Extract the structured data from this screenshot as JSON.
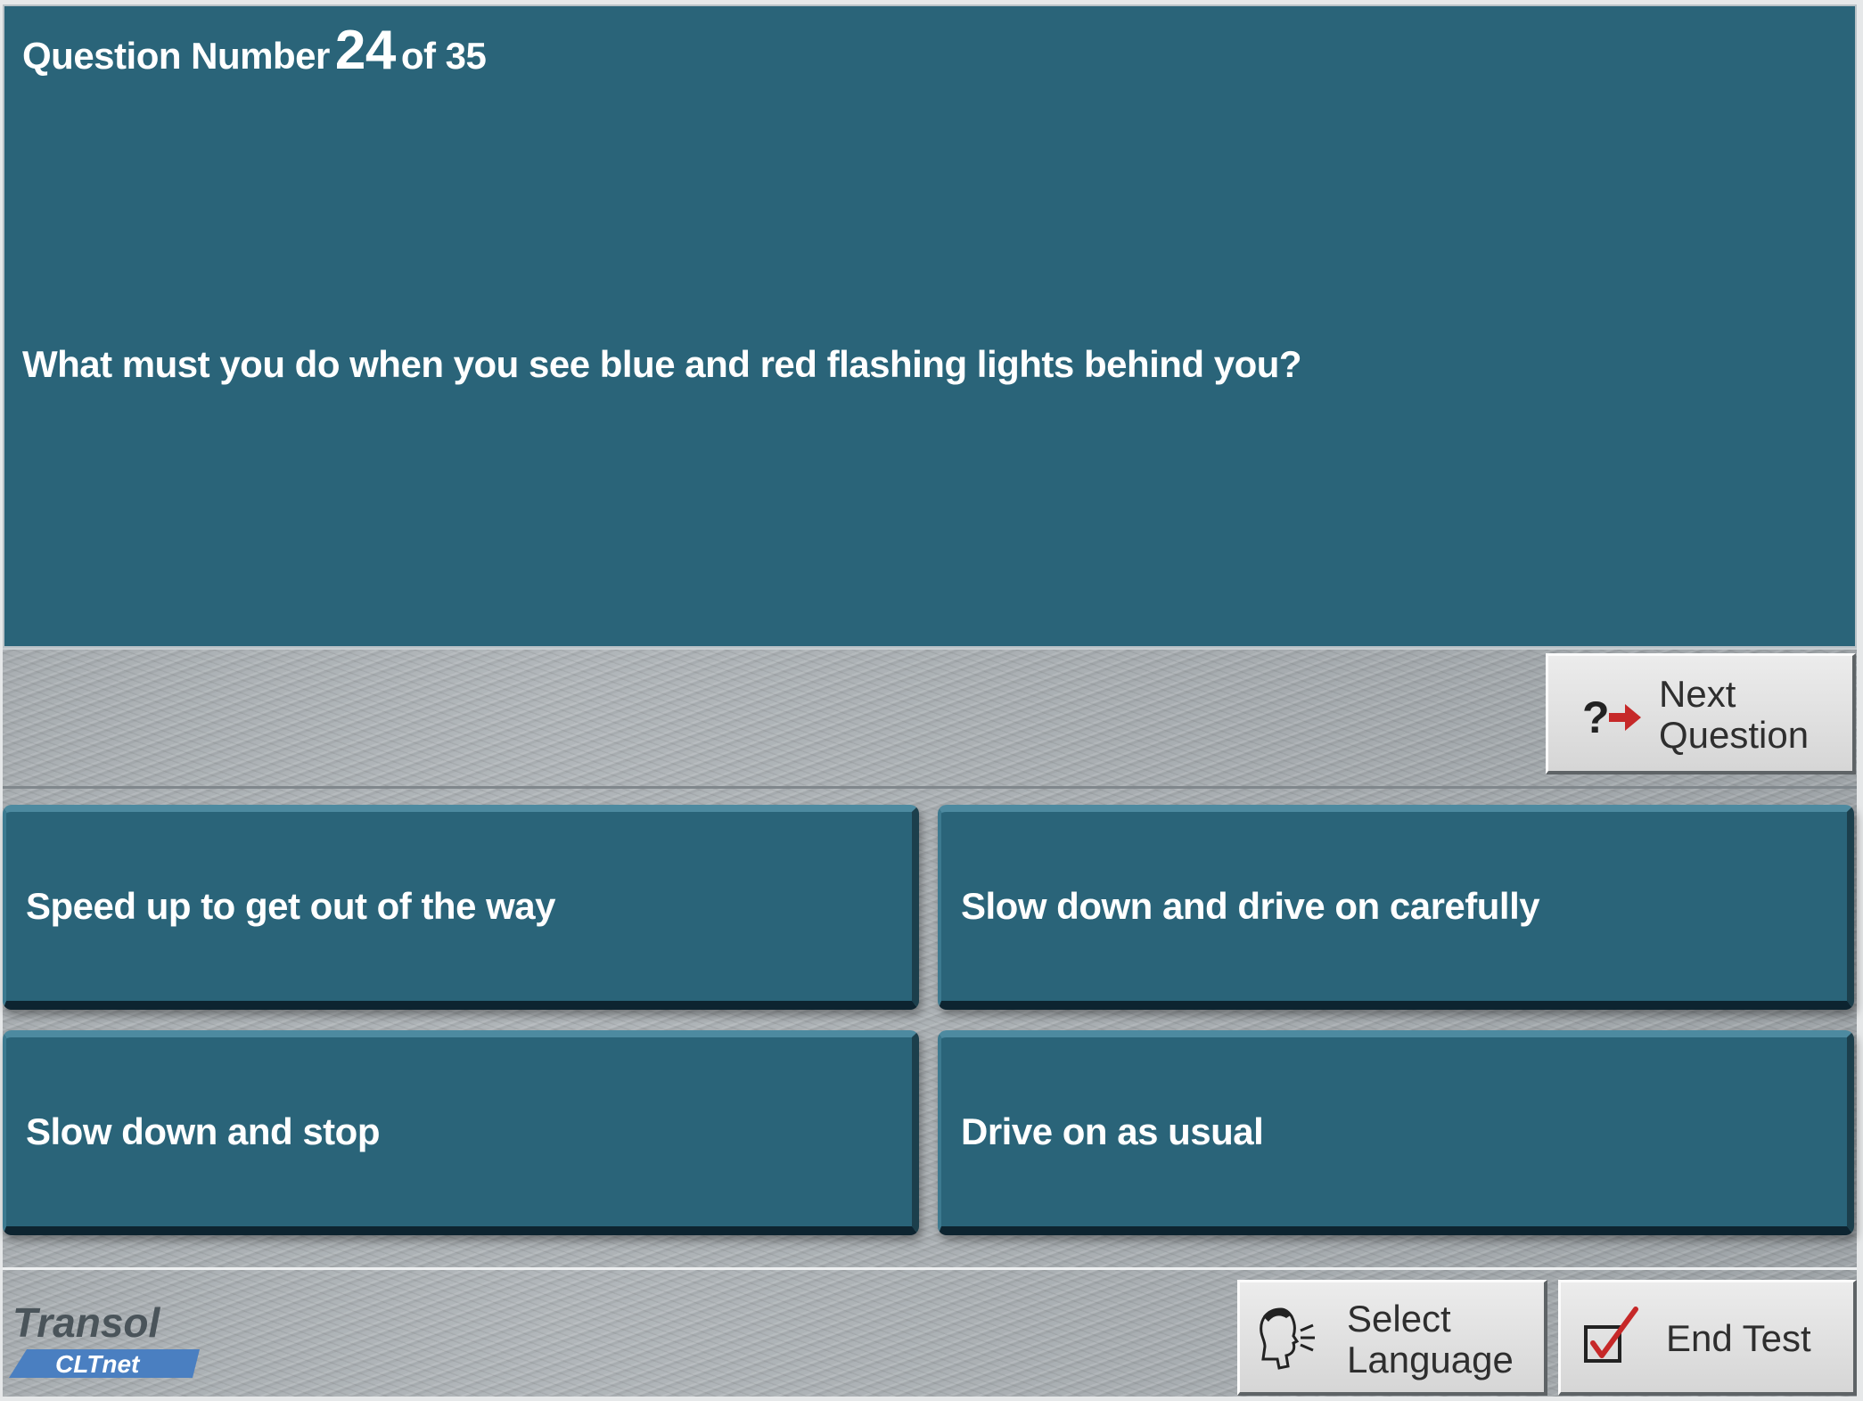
{
  "header": {
    "question_prefix": "Question Number",
    "question_number": "24",
    "question_suffix": "of 35"
  },
  "question": {
    "text": "What must you do when you see blue and red flashing lights behind you?"
  },
  "answers": [
    {
      "label": "Speed up to get out of the way"
    },
    {
      "label": "Slow down and drive on carefully"
    },
    {
      "label": "Slow down and stop"
    },
    {
      "label": "Drive on as usual"
    }
  ],
  "buttons": {
    "next_line1": "Next",
    "next_line2": "Question",
    "language_line1": "Select",
    "language_line2": "Language",
    "end_test": "End Test"
  },
  "icons": {
    "next": "question-arrow-icon",
    "language": "speaking-head-icon",
    "end_test": "checkbox-check-icon"
  },
  "logo": {
    "brand": "Transol",
    "sub": "CLTnet"
  },
  "colors": {
    "panel": "#2a6479",
    "text": "#ffffff",
    "button_face": "#e3e3e3",
    "accent_red": "#c62828"
  }
}
